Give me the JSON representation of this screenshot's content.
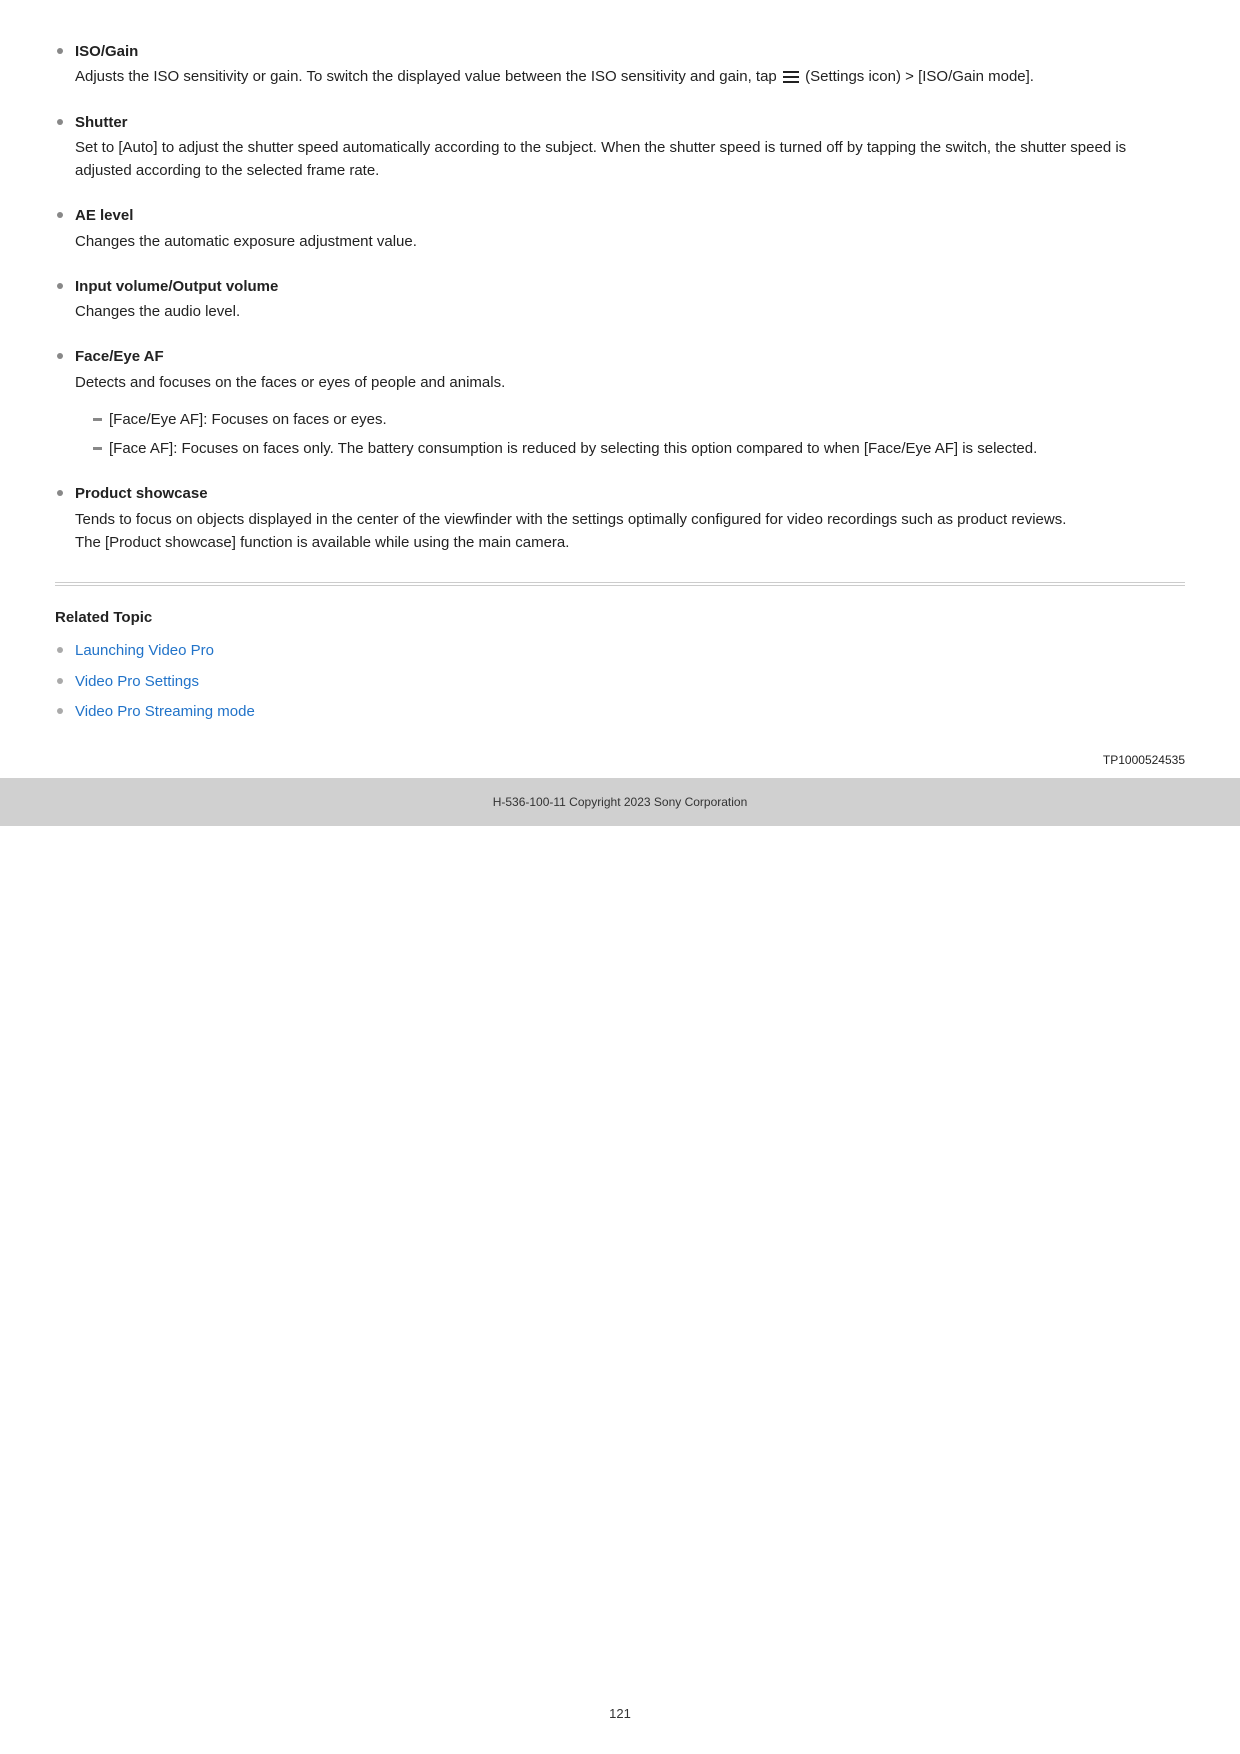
{
  "features": [
    {
      "title": "ISO/Gain",
      "desc_before": "Adjusts the ISO sensitivity or gain. To switch the displayed value between the ISO sensitivity and gain, tap ",
      "desc_after": " (Settings icon) > [ISO/Gain mode].",
      "has_icon": true
    },
    {
      "title": "Shutter",
      "desc": "Set to [Auto] to adjust the shutter speed automatically according to the subject. When the shutter speed is turned off by tapping the switch, the shutter speed is adjusted according to the selected frame rate."
    },
    {
      "title": "AE level",
      "desc": "Changes the automatic exposure adjustment value."
    },
    {
      "title": "Input volume/Output volume",
      "desc": "Changes the audio level."
    },
    {
      "title": "Face/Eye AF",
      "desc": "Detects and focuses on the faces or eyes of people and animals.",
      "sub": [
        "[Face/Eye AF]: Focuses on faces or eyes.",
        "[Face AF]: Focuses on faces only. The battery consumption is reduced by selecting this option compared to when [Face/Eye AF] is selected."
      ]
    },
    {
      "title": "Product showcase",
      "desc": "Tends to focus on objects displayed in the center of the viewfinder with the settings optimally configured for video recordings such as product reviews.\nThe [Product showcase] function is available while using the main camera."
    }
  ],
  "related": {
    "title": "Related Topic",
    "links": [
      "Launching Video Pro",
      "Video Pro Settings",
      "Video Pro Streaming mode"
    ]
  },
  "docnum": "TP1000524535",
  "copyright": "H-536-100-11 Copyright 2023 Sony Corporation",
  "page_number": "121"
}
